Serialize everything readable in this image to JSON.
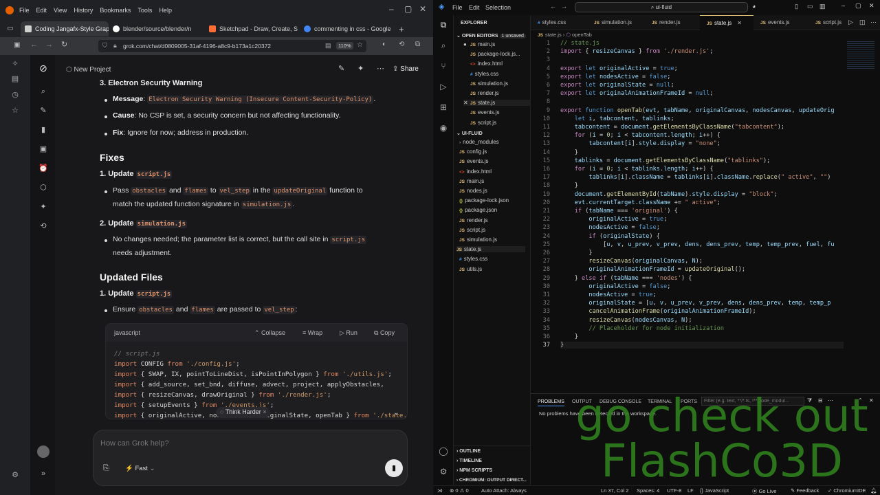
{
  "browser": {
    "menu": [
      "File",
      "Edit",
      "View",
      "History",
      "Bookmarks",
      "Tools",
      "Help"
    ],
    "tabs": [
      {
        "label": "Coding Jangafx-Style Graphic",
        "color": "#d0d0d0",
        "active": true
      },
      {
        "label": "blender/source/blender/n",
        "color": "#ffffff",
        "active": false
      },
      {
        "label": "Sketchpad - Draw, Create, S",
        "color": "#ff6b35",
        "active": false
      },
      {
        "label": "commenting in css - Google",
        "color": "#4285f4",
        "active": false
      }
    ],
    "new_tab": "+",
    "url": "grok.com/chat/d0809005-31af-4196-a8c9-b173a1c20372",
    "zoom": "110%"
  },
  "grok": {
    "new_project": "New Project",
    "share": "Share",
    "sec3_title": "3. Electron Security Warning",
    "msg_label": "Message",
    "msg_code": "Electron Security Warning (Insecure Content-Security-Policy)",
    "cause_label": "Cause",
    "cause_text": ": No CSP is set, a security concern but not affecting functionality.",
    "fix_label": "Fix",
    "fix_text": ": Ignore for now; address in production.",
    "fixes_heading": "Fixes",
    "u1_prefix": "1. Update ",
    "u1_code": "script.js",
    "pass1": "Pass ",
    "obstacles": "obstacles",
    "and": " and ",
    "flames": "flames",
    "to": " to ",
    "vel_step": "vel_step",
    "in_the": " in the ",
    "updateOriginal": "updateOriginal",
    "function_to": " function to",
    "match_line": "match the updated function signature in ",
    "sim_js": "simulation.js",
    "period": ".",
    "u2_prefix": "2. Update ",
    "u2_code": "simulation.js",
    "nochange": "No changes needed; the parameter list is correct, but the call site in ",
    "script_js": "script.js",
    "needs_adj": "needs adjustment.",
    "updated_heading": "Updated Files",
    "u3_prefix": "1. Update ",
    "u3_code": "script.js",
    "ensure": "Ensure ",
    "are_passed": " are passed to ",
    "colon": ":",
    "code_lang": "javascript",
    "collapse": "Collapse",
    "wrap": "Wrap",
    "run": "Run",
    "copy": "Copy",
    "think_harder": "Think Harder",
    "placeholder": "How can Grok help?",
    "mode": "Fast"
  },
  "vscode": {
    "menu": [
      "File",
      "Edit",
      "Selection"
    ],
    "search": "ui-fluid",
    "tabs": [
      "styles.css",
      "simulation.js",
      "render.js",
      "state.js",
      "events.js",
      "script.js"
    ],
    "breadcrumb_file": "state.js",
    "breadcrumb_fn": "openTab",
    "explorer_title": "EXPLORER",
    "open_editors": "OPEN EDITORS",
    "unsaved": "1 unsaved",
    "open_files": [
      "main.js",
      "package-lock.js...",
      "index.html",
      "styles.css",
      "simulation.js",
      "render.js",
      "state.js",
      "events.js",
      "script.js"
    ],
    "project": "UI-FLUID",
    "project_files": [
      "node_modules",
      "config.js",
      "events.js",
      "index.html",
      "main.js",
      "nodes.js",
      "package-lock.json",
      "package.json",
      "render.js",
      "script.js",
      "simulation.js",
      "state.js",
      "styles.css",
      "utils.js"
    ],
    "outline_sections": [
      "OUTLINE",
      "TIMELINE",
      "NPM SCRIPTS",
      "CHROMIUM: OUTPUT DIRECT..."
    ],
    "panel_tabs": [
      "PROBLEMS",
      "OUTPUT",
      "DEBUG CONSOLE",
      "TERMINAL",
      "PORTS"
    ],
    "filter": "Filter (e.g. text, **/*.ts, !**/node_modul...",
    "problems_msg": "No problems have been detected in the workspace.",
    "status": {
      "errors": "0",
      "warnings": "0",
      "attach": "Auto Attach: Always",
      "pos": "Ln 37, Col 2",
      "spaces": "Spaces: 4",
      "enc": "UTF-8",
      "eol": "LF",
      "lang": "JavaScript",
      "live": "Go Live",
      "feedback": "Feedback",
      "ide": "ChromiumIDE"
    }
  },
  "watermark": [
    "go check out",
    "FlashCo3D"
  ],
  "colors": {
    "accent_blue": "#4a9eff",
    "js_yellow": "#e5c07b",
    "watermark_green": "#2e7d1e",
    "code_orange": "#e0936b"
  }
}
